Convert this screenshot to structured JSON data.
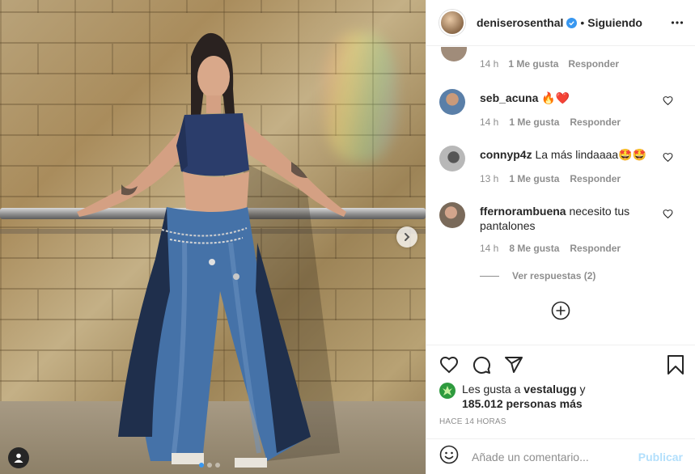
{
  "post": {
    "user": {
      "username": "deniserosenthal",
      "verified": true,
      "follow_status": "Siguiendo",
      "separator": "•"
    },
    "photo": {
      "carousel_count": 3,
      "active_index": 0
    },
    "comments_partial_meta": {
      "time": "14 h",
      "likes": "1 Me gusta",
      "reply": "Responder"
    },
    "comments": [
      {
        "username": "seb_acuna",
        "text": "🔥❤️",
        "time": "14 h",
        "likes": "1 Me gusta",
        "reply": "Responder",
        "avatar_color": "#5a7fa8"
      },
      {
        "username": "connyp4z",
        "text": "La más lindaaaa🤩🤩",
        "time": "13 h",
        "likes": "1 Me gusta",
        "reply": "Responder",
        "avatar_color": "#9a9a9a"
      },
      {
        "username": "ffernorambuena",
        "text": "necesito tus pantalones",
        "time": "14 h",
        "likes": "8 Me gusta",
        "reply": "Responder",
        "avatar_color": "#7a6a5a"
      }
    ],
    "view_replies": "Ver respuestas (2)",
    "likes": {
      "prefix": "Les gusta a ",
      "user": "vestalugg",
      "middle": " y ",
      "count": "185.012 personas más"
    },
    "timestamp": "HACE 14 HORAS",
    "add_comment": {
      "placeholder": "Añade un comentario...",
      "publish": "Publicar"
    },
    "icons": [
      "heart-icon",
      "comment-icon",
      "share-icon",
      "bookmark-icon",
      "more-options-icon",
      "emoji-icon",
      "plus-circle-icon",
      "next-arrow-icon",
      "user-tag-icon",
      "verified-badge-icon"
    ]
  }
}
